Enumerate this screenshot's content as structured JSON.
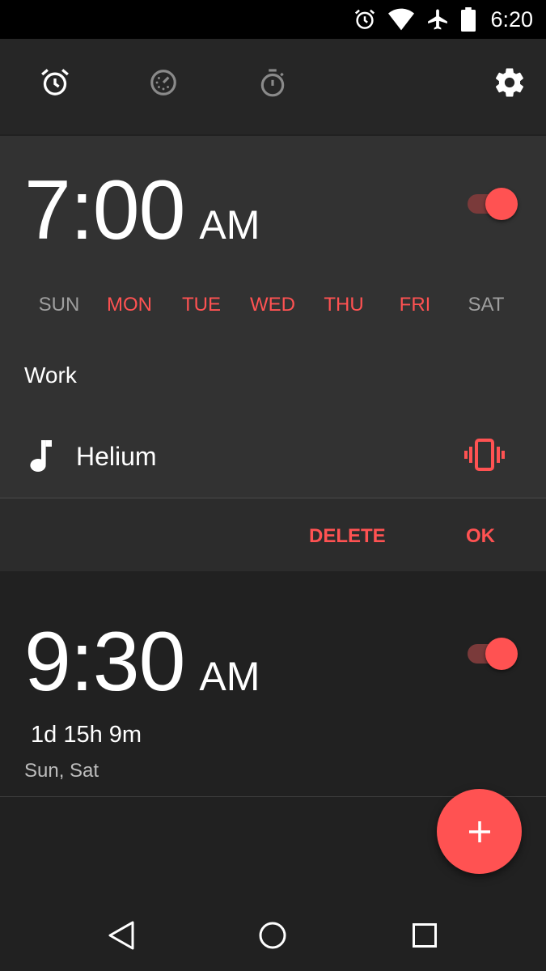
{
  "status_bar": {
    "time": "6:20",
    "icons": [
      "alarm-icon",
      "wifi-icon",
      "airplane-icon",
      "battery-icon"
    ]
  },
  "tabs": [
    {
      "name": "alarm",
      "icon": "alarm-clock-icon",
      "active": true
    },
    {
      "name": "clock",
      "icon": "clock-icon",
      "active": false
    },
    {
      "name": "stopwatch",
      "icon": "stopwatch-icon",
      "active": false
    }
  ],
  "toolbar": {
    "settings_icon": "gear-icon"
  },
  "alarms": [
    {
      "time": "7:00",
      "ampm": "AM",
      "enabled": true,
      "days": [
        {
          "label": "SUN",
          "on": false
        },
        {
          "label": "MON",
          "on": true
        },
        {
          "label": "TUE",
          "on": true
        },
        {
          "label": "WED",
          "on": true
        },
        {
          "label": "THU",
          "on": true
        },
        {
          "label": "FRI",
          "on": true
        },
        {
          "label": "SAT",
          "on": false
        }
      ],
      "label": "Work",
      "ringtone": "Helium",
      "vibrate": true,
      "actions": {
        "delete": "DELETE",
        "ok": "OK"
      }
    },
    {
      "time": "9:30",
      "ampm": "AM",
      "enabled": true,
      "countdown": "1d 15h 9m",
      "repeat": "Sun, Sat"
    }
  ],
  "fab": {
    "icon": "plus-icon"
  },
  "nav": {
    "icons": [
      "back-icon",
      "home-icon",
      "recents-icon"
    ]
  },
  "colors": {
    "accent": "#ff5252",
    "background": "#212121",
    "card_expanded": "#323232",
    "toolbar": "#262626",
    "status_bar": "#000000"
  }
}
